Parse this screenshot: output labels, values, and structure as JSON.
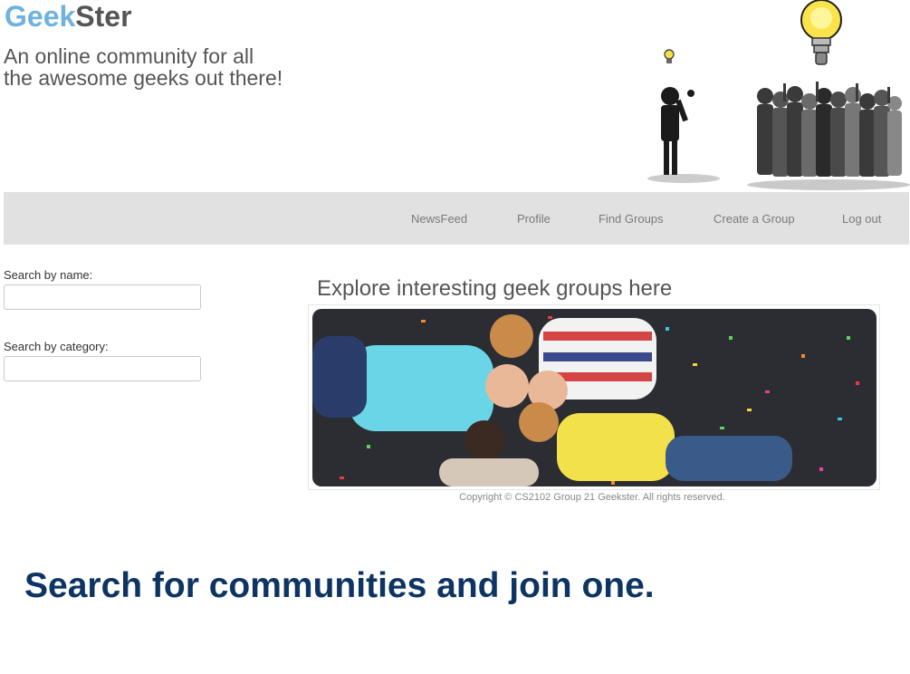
{
  "header": {
    "logo_part1": "Geek",
    "logo_part2": "Ster",
    "tagline": "An online community for all the awesome geeks out there!"
  },
  "nav": {
    "items": [
      {
        "label": "NewsFeed"
      },
      {
        "label": "Profile"
      },
      {
        "label": "Find Groups"
      },
      {
        "label": "Create a Group"
      },
      {
        "label": "Log out"
      }
    ]
  },
  "sidebar": {
    "name_label": "Search by name:",
    "category_label": "Search by category:",
    "name_value": "",
    "category_value": ""
  },
  "main": {
    "title": "Explore interesting geek groups here",
    "copyright": "Copyright © CS2102 Group 21 Geekster. All rights reserved."
  },
  "caption": "Search for communities and join one.",
  "colors": {
    "logo_geek": "#6fb2e0",
    "logo_ster": "#555555",
    "nav_bg": "#e0e1e0",
    "caption": "#0d3463"
  }
}
